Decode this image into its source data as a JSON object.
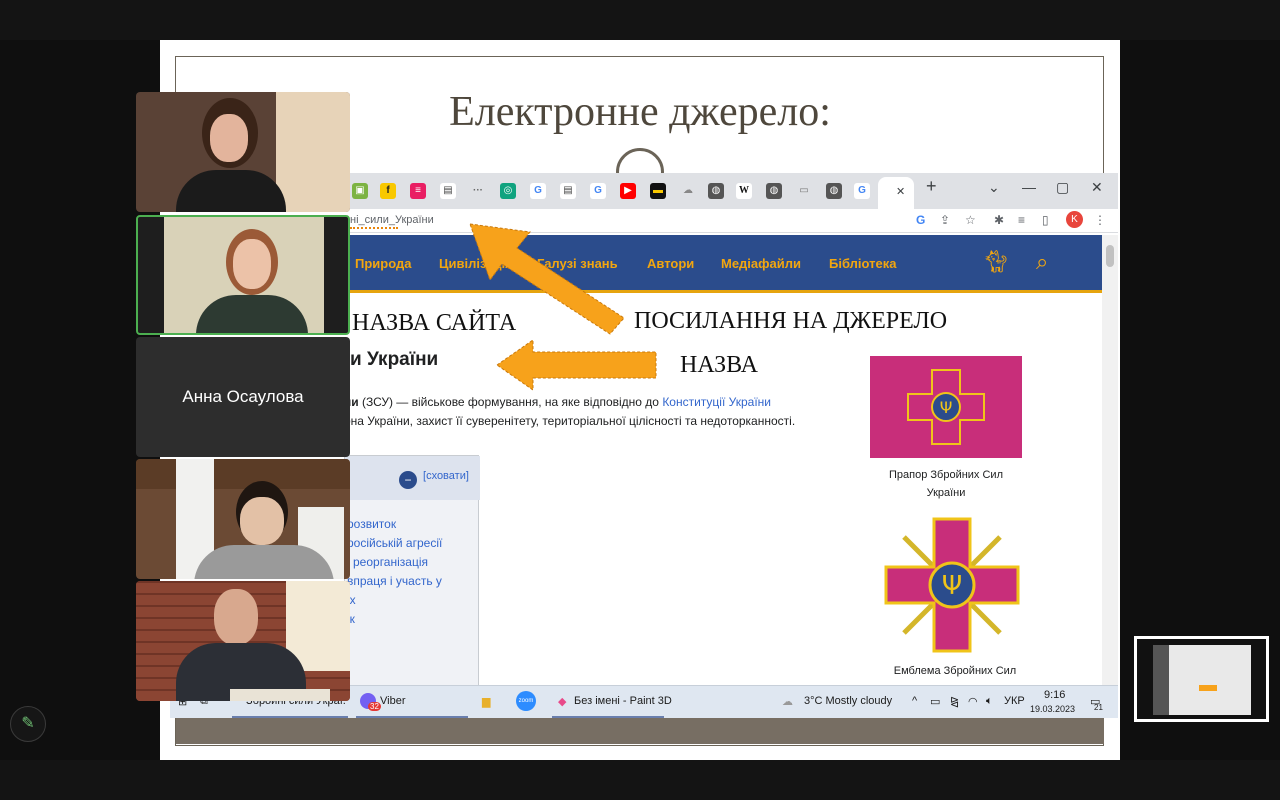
{
  "slide": {
    "title": "Електронне джерело:",
    "annotations": {
      "site_name": "НАЗВА САЙТА",
      "source_link": "ПОСИЛАННЯ НА ДЖЕРЕЛО",
      "name": "НАЗВА"
    },
    "arrow_color": "#f7a21b"
  },
  "browser": {
    "url_fragment": "ні_сили_України",
    "nav_items": [
      "Природа",
      "Цивілізація",
      "Галузі знань",
      "Автори",
      "Медіафайли",
      "Бібліотека"
    ],
    "window_controls": [
      "⌄",
      "—",
      "▢",
      "✕"
    ],
    "new_tab": "+",
    "close_tab": "✕",
    "profile_letter": "K"
  },
  "article": {
    "heading": "и України",
    "paragraph_line1_prefix": "ни",
    "paragraph_line1_abbr": "(ЗСУ) — військове формування, на яке відповідно до",
    "paragraph_line1_link": "Конституції України",
    "paragraph_line2": "она України, захист її суверенітету, територіальної цілісності та недоторканності.",
    "toc_hide": "сховати",
    "toc_items": [
      "розвиток",
      "російській агресії",
      "і реорганізація",
      "впраця і участь у",
      "іх",
      "ік"
    ],
    "flag_caption_1": "Прапор Збройних Сил",
    "flag_caption_2": "України",
    "emblem_caption": "Емблема Збройних Сил"
  },
  "taskbar": {
    "app1": "Збройні сили Украї...",
    "viber": "Viber",
    "viber_badge": "32",
    "zoom": "zoom",
    "paint": "Без імені - Paint 3D",
    "weather": "3°C  Mostly cloudy",
    "lang": "УКР",
    "time": "9:16",
    "date": "19.03.2023",
    "notif": "21"
  },
  "participants": {
    "named_tile": "Анна Осаулова"
  },
  "colors": {
    "nav_bg": "#2b4c8c",
    "nav_text": "#f2a60f",
    "flag": "#c82e7a"
  }
}
